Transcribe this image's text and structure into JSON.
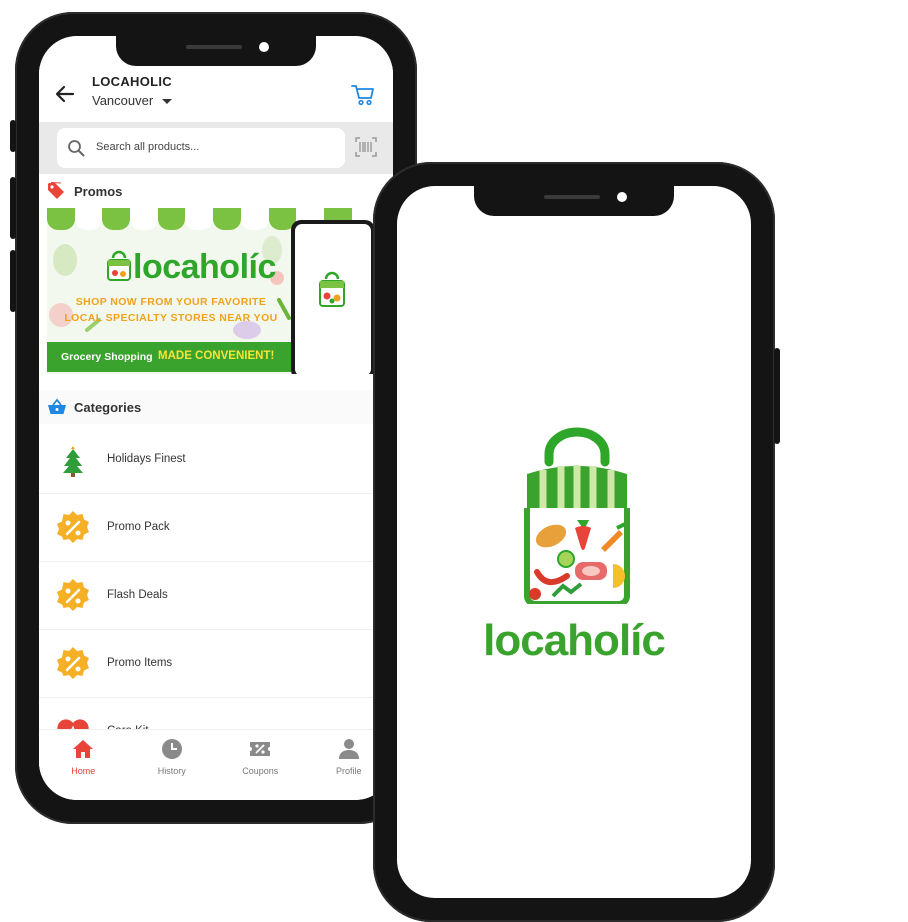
{
  "header": {
    "app_name": "LOCAHOLIC",
    "city": "Vancouver"
  },
  "search": {
    "placeholder": "Search all products..."
  },
  "promos": {
    "title": "Promos",
    "banner": {
      "logo_text": "locaholíc",
      "line1": "SHOP NOW FROM YOUR FAVORITE",
      "line2": "LOCAL SPECIALTY STORES NEAR YOU",
      "strip_text": "Grocery Shopping",
      "strip_highlight": "MADE CONVENIENT!"
    }
  },
  "categories": {
    "title": "Categories",
    "items": [
      {
        "label": "Holidays Finest",
        "icon": "christmas-tree-icon"
      },
      {
        "label": "Promo Pack",
        "icon": "percent-badge-icon"
      },
      {
        "label": "Flash Deals",
        "icon": "percent-badge-icon"
      },
      {
        "label": "Promo Items",
        "icon": "percent-badge-icon"
      },
      {
        "label": "Care Kit",
        "icon": "care-kit-icon"
      }
    ]
  },
  "tabbar": {
    "items": [
      {
        "label": "Home",
        "icon": "home-icon",
        "active": true
      },
      {
        "label": "History",
        "icon": "clock-icon",
        "active": false
      },
      {
        "label": "Coupons",
        "icon": "coupon-icon",
        "active": false
      },
      {
        "label": "Profile",
        "icon": "person-icon",
        "active": false
      }
    ]
  },
  "splash": {
    "brand": "locaholíc"
  },
  "colors": {
    "brand_green": "#3aa32d",
    "accent_red": "#e8443a",
    "promo_orange": "#f0a21b",
    "link_blue": "#1e88e5"
  }
}
